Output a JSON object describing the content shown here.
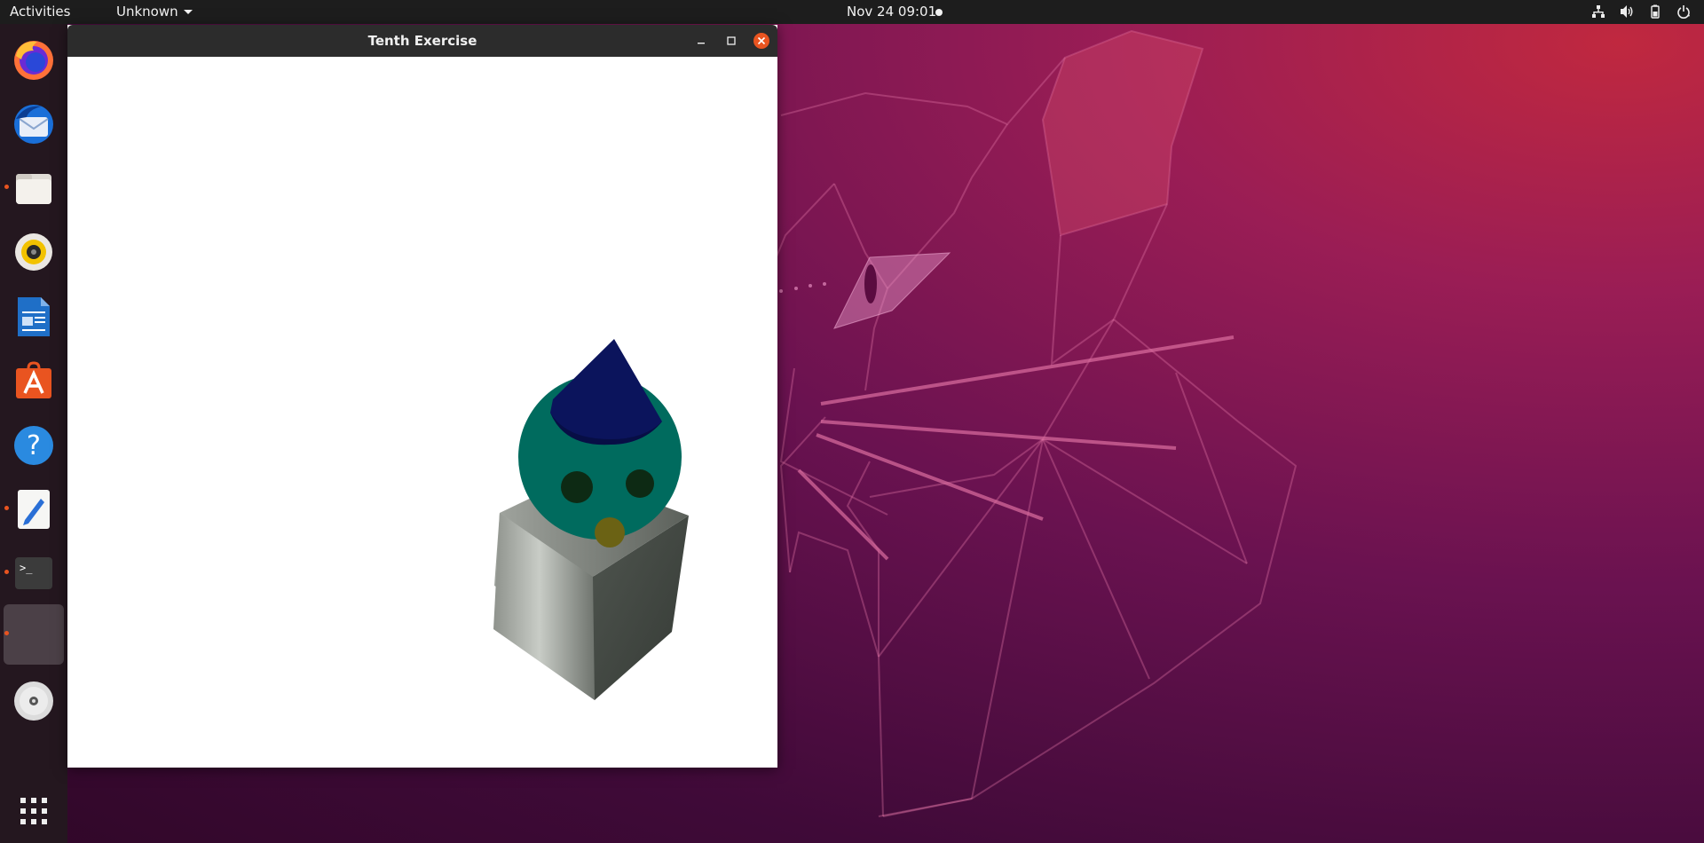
{
  "topbar": {
    "activities": "Activities",
    "app_menu": "Unknown",
    "clock": "Nov 24  09:01",
    "tray_icons": [
      "network-icon",
      "volume-icon",
      "battery-icon",
      "power-icon"
    ]
  },
  "dock": {
    "items": [
      {
        "name": "firefox",
        "icon": "firefox-icon",
        "running": false
      },
      {
        "name": "thunderbird",
        "icon": "thunderbird-icon",
        "running": false
      },
      {
        "name": "files",
        "icon": "files-icon",
        "running": true
      },
      {
        "name": "rhythmbox",
        "icon": "rhythmbox-icon",
        "running": false
      },
      {
        "name": "libreoffice-writer",
        "icon": "writer-icon",
        "running": false
      },
      {
        "name": "software",
        "icon": "software-center-icon",
        "running": false
      },
      {
        "name": "help",
        "icon": "help-icon",
        "running": false
      },
      {
        "name": "text-editor",
        "icon": "text-editor-icon",
        "running": true
      },
      {
        "name": "terminal",
        "icon": "terminal-icon",
        "running": true
      },
      {
        "name": "opengl-app",
        "icon": "blank-app-icon",
        "running": true,
        "active": true
      },
      {
        "name": "dvd",
        "icon": "disc-icon",
        "running": false
      }
    ],
    "show_apps": "show-applications-icon"
  },
  "window": {
    "title": "Tenth Exercise",
    "controls": [
      "minimize",
      "maximize",
      "close"
    ]
  },
  "scene": {
    "objects": [
      "cone",
      "sphere",
      "cube"
    ],
    "colors": {
      "cone": "#0b145c",
      "sphere": "#006b5e",
      "eyes": "#0d2a14",
      "nose": "#6b6214",
      "cube_light": "#c9cdc6",
      "cube_dark": "#3c423c"
    }
  },
  "colors": {
    "accent": "#e95420",
    "topbar": "#1d1d1d",
    "dock": "#24171f",
    "titlebar": "#2c2c2c"
  }
}
